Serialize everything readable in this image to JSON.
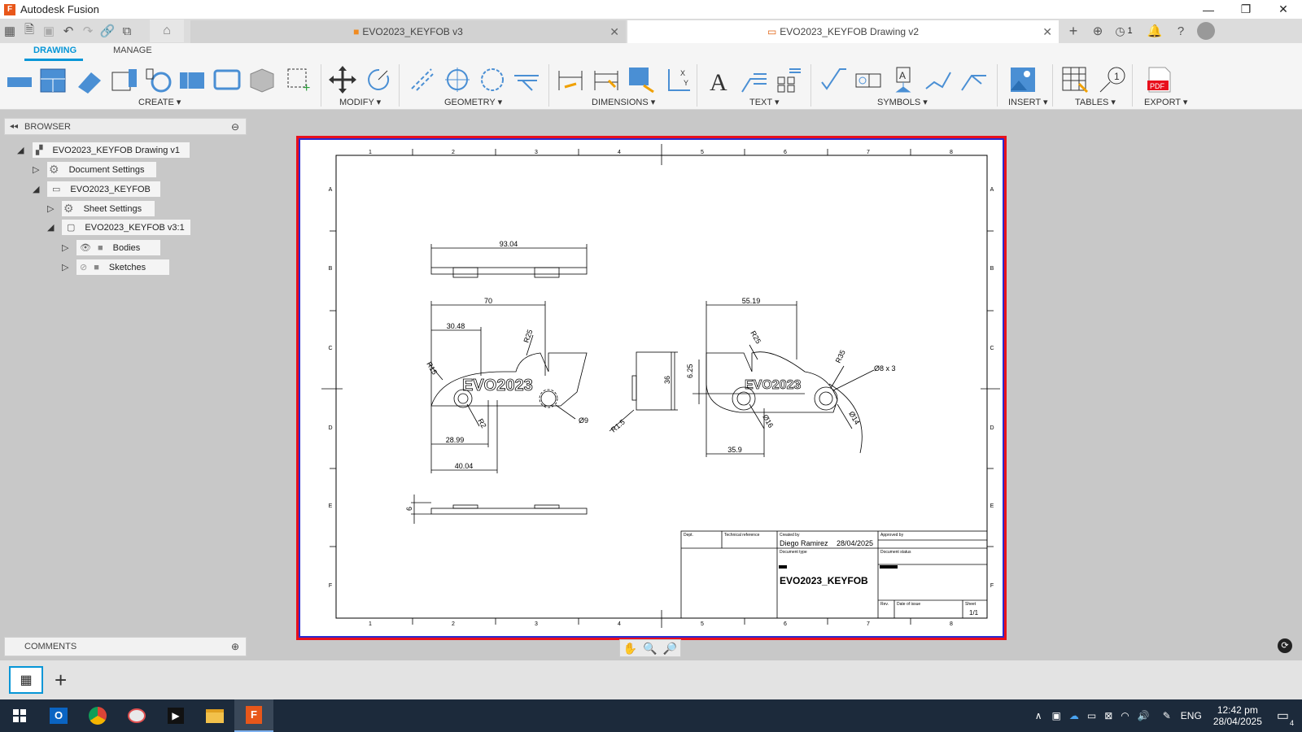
{
  "app": {
    "title": "Autodesk Fusion",
    "logo_letter": "F"
  },
  "window": {
    "min": "—",
    "restore": "❐",
    "close": "✕"
  },
  "tabs": [
    {
      "label": "EVO2023_KEYFOB v3",
      "active": false
    },
    {
      "label": "EVO2023_KEYFOB Drawing v2",
      "active": true
    }
  ],
  "header_right": {
    "job_count": "1"
  },
  "ribbon_tabs": [
    "DRAWING",
    "MANAGE"
  ],
  "groups": [
    "CREATE",
    "MODIFY",
    "GEOMETRY",
    "DIMENSIONS",
    "TEXT",
    "SYMBOLS",
    "INSERT",
    "TABLES",
    "EXPORT"
  ],
  "browser": {
    "title": "BROWSER",
    "nodes": [
      {
        "label": "EVO2023_KEYFOB Drawing v1"
      },
      {
        "label": "Document Settings"
      },
      {
        "label": "EVO2023_KEYFOB"
      },
      {
        "label": "Sheet Settings"
      },
      {
        "label": "EVO2023_KEYFOB v3:1"
      },
      {
        "label": "Bodies"
      },
      {
        "label": "Sketches"
      }
    ]
  },
  "comments": {
    "title": "COMMENTS"
  },
  "drawing": {
    "zone_cols": [
      "1",
      "2",
      "3",
      "4",
      "5",
      "6",
      "7",
      "8"
    ],
    "zone_rows": [
      "A",
      "B",
      "C",
      "D",
      "E",
      "F"
    ],
    "dims": [
      "93.04",
      "70",
      "30.48",
      "R25",
      "R15",
      "R2",
      "Ø9",
      "28.99",
      "40.04",
      "R1.5",
      "36",
      "6.25",
      "55.19",
      "R25",
      "R35",
      "Ø8 x 3",
      "Ø16",
      "Ø14",
      "35.9",
      "6"
    ],
    "keyfob_text_left": "EVO2023",
    "keyfob_text_right": "EVO2023",
    "title_block": {
      "dept": "Dept.",
      "tech_ref": "Technical reference",
      "created_by_label": "Created by",
      "created_by": "Diego Ramirez",
      "date": "28/04/2025",
      "approved_by": "Approved by",
      "doc_type": "Document type",
      "doc_status": "Document status",
      "title": "EVO2023_KEYFOB",
      "rev": "Rev.",
      "date_of_issue": "Date of issue",
      "sheet_label": "Sheet",
      "sheet": "1/1"
    }
  },
  "taskbar": {
    "language": "ENG",
    "time": "12:42 pm",
    "date": "28/04/2025",
    "notifications": "4"
  },
  "colors": {
    "accent": "#0696d7",
    "sheet_border_outer": "#e8101c",
    "sheet_border_inner": "#2a2ad0",
    "taskbar": "#1c2a3b"
  }
}
